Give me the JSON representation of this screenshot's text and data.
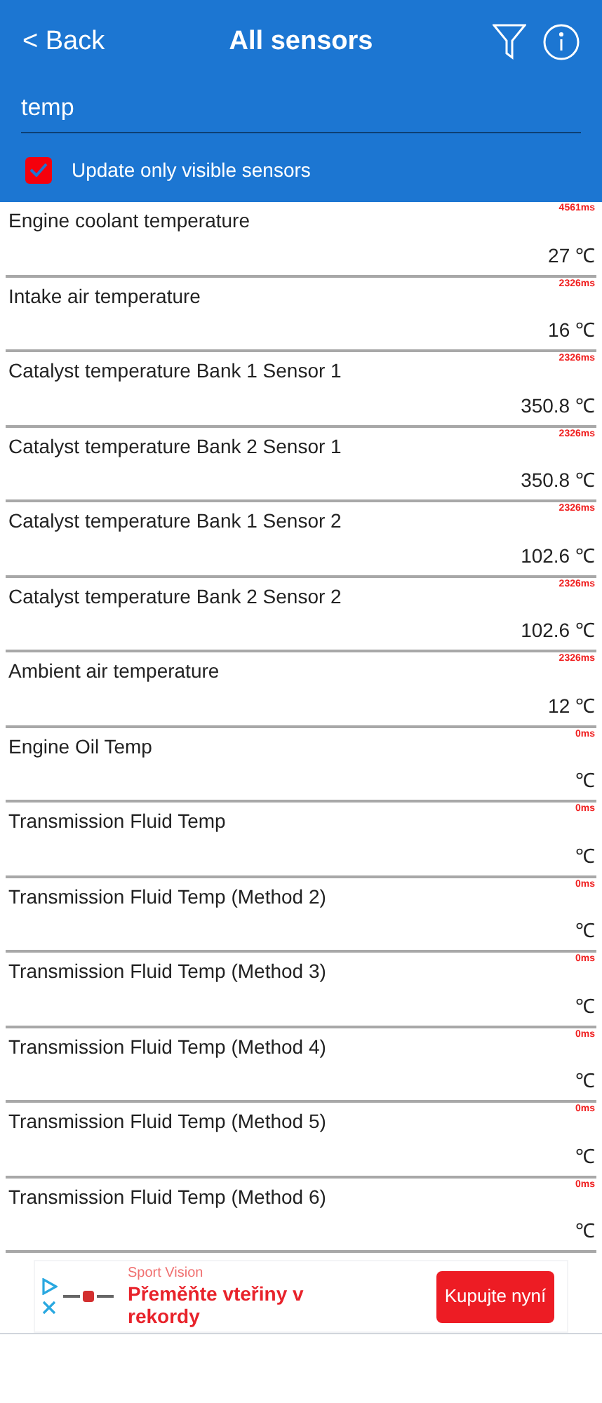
{
  "header": {
    "back": "< Back",
    "title": "All sensors"
  },
  "search": {
    "value": "temp"
  },
  "update_only_visible": {
    "label": "Update only visible sensors",
    "checked": true
  },
  "sensors": [
    {
      "name": "Engine coolant temperature",
      "time": "4561ms",
      "value": "27 ℃"
    },
    {
      "name": "Intake air temperature",
      "time": "2326ms",
      "value": "16 ℃"
    },
    {
      "name": "Catalyst temperature Bank 1 Sensor 1",
      "time": "2326ms",
      "value": "350.8 ℃"
    },
    {
      "name": "Catalyst temperature Bank 2 Sensor 1",
      "time": "2326ms",
      "value": "350.8 ℃"
    },
    {
      "name": "Catalyst temperature Bank 1 Sensor 2",
      "time": "2326ms",
      "value": "102.6 ℃"
    },
    {
      "name": "Catalyst temperature Bank 2 Sensor 2",
      "time": "2326ms",
      "value": "102.6 ℃"
    },
    {
      "name": "Ambient air temperature",
      "time": "2326ms",
      "value": "12 ℃"
    },
    {
      "name": "Engine Oil Temp",
      "time": "0ms",
      "value": "℃"
    },
    {
      "name": "Transmission Fluid Temp",
      "time": "0ms",
      "value": "℃"
    },
    {
      "name": "Transmission Fluid Temp (Method 2)",
      "time": "0ms",
      "value": "℃"
    },
    {
      "name": "Transmission Fluid Temp (Method 3)",
      "time": "0ms",
      "value": "℃"
    },
    {
      "name": "Transmission Fluid Temp (Method 4)",
      "time": "0ms",
      "value": "℃"
    },
    {
      "name": "Transmission Fluid Temp (Method 5)",
      "time": "0ms",
      "value": "℃"
    },
    {
      "name": "Transmission Fluid Temp (Method 6)",
      "time": "0ms",
      "value": "℃"
    }
  ],
  "ad": {
    "advertiser": "Sport Vision",
    "headline": "Přeměňte vteřiny v rekordy",
    "button": "Kupujte nyní"
  }
}
